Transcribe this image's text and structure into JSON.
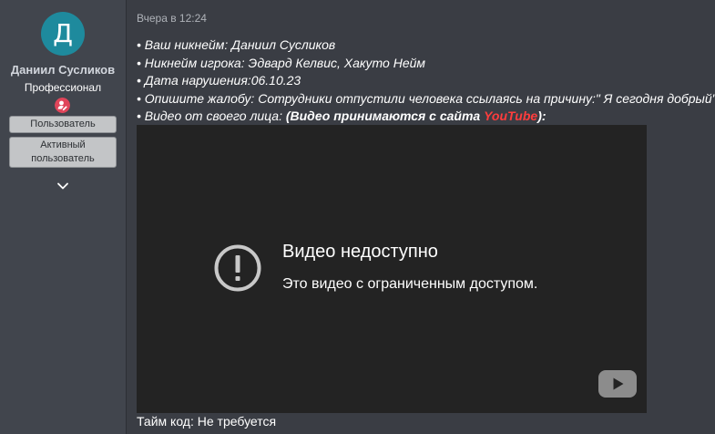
{
  "colors": {
    "page_background": "#3a3d44",
    "sidebar_background": "#41454d",
    "avatar_background": "#1e8a9d",
    "rank_badge": "#e0455a",
    "link_accent": "#ff3d3d",
    "video_background": "#232323"
  },
  "user": {
    "avatar_letter": "Д",
    "name": "Даниил Сусликов",
    "title": "Профессионал",
    "rank_icon": "user-edit-icon",
    "banners": [
      "Пользователь",
      "Активный",
      "пользователь"
    ],
    "expand_icon": "chevron-down-icon"
  },
  "post": {
    "date": "Вчера в 12:24",
    "lines": [
      "• Ваш никнейм: Даниил Сусликов",
      "• Никнейм игрока: Эдвард Келвис, Хакуто Нейм",
      "• Дата нарушения:06.10.23",
      "• Опишите жалобу: Сотрудники отпустили человека ссылаясь на причину:\" Я сегодня добрый\", та"
    ],
    "video_line": {
      "prefix": "• Видео от своего лица: ",
      "bold_open": "(Видео принимаются с сайта ",
      "link": "YouTube",
      "bold_close": "):"
    },
    "timecode": "Тайм код: Не требуется"
  },
  "video": {
    "title": "Видео недоступно",
    "subtitle": "Это видео с ограниченным доступом.",
    "alert_icon": "exclamation-circle-icon",
    "logo_icon": "youtube-logo-icon"
  }
}
